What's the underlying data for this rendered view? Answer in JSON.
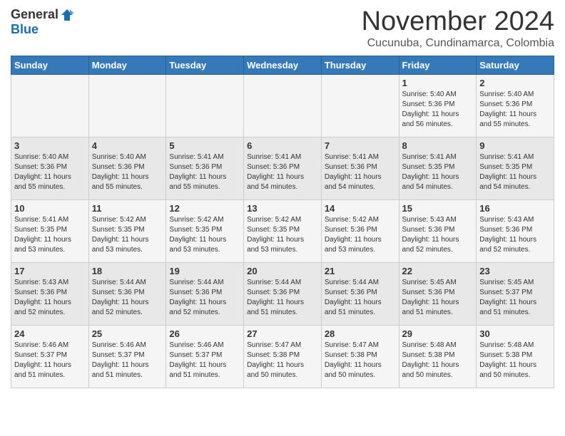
{
  "header": {
    "logo_general": "General",
    "logo_blue": "Blue",
    "month_title": "November 2024",
    "location": "Cucunuba, Cundinamarca, Colombia"
  },
  "weekdays": [
    "Sunday",
    "Monday",
    "Tuesday",
    "Wednesday",
    "Thursday",
    "Friday",
    "Saturday"
  ],
  "weeks": [
    [
      {
        "day": "",
        "info": ""
      },
      {
        "day": "",
        "info": ""
      },
      {
        "day": "",
        "info": ""
      },
      {
        "day": "",
        "info": ""
      },
      {
        "day": "",
        "info": ""
      },
      {
        "day": "1",
        "info": "Sunrise: 5:40 AM\nSunset: 5:36 PM\nDaylight: 11 hours\nand 56 minutes."
      },
      {
        "day": "2",
        "info": "Sunrise: 5:40 AM\nSunset: 5:36 PM\nDaylight: 11 hours\nand 55 minutes."
      }
    ],
    [
      {
        "day": "3",
        "info": "Sunrise: 5:40 AM\nSunset: 5:36 PM\nDaylight: 11 hours\nand 55 minutes."
      },
      {
        "day": "4",
        "info": "Sunrise: 5:40 AM\nSunset: 5:36 PM\nDaylight: 11 hours\nand 55 minutes."
      },
      {
        "day": "5",
        "info": "Sunrise: 5:41 AM\nSunset: 5:36 PM\nDaylight: 11 hours\nand 55 minutes."
      },
      {
        "day": "6",
        "info": "Sunrise: 5:41 AM\nSunset: 5:36 PM\nDaylight: 11 hours\nand 54 minutes."
      },
      {
        "day": "7",
        "info": "Sunrise: 5:41 AM\nSunset: 5:36 PM\nDaylight: 11 hours\nand 54 minutes."
      },
      {
        "day": "8",
        "info": "Sunrise: 5:41 AM\nSunset: 5:35 PM\nDaylight: 11 hours\nand 54 minutes."
      },
      {
        "day": "9",
        "info": "Sunrise: 5:41 AM\nSunset: 5:35 PM\nDaylight: 11 hours\nand 54 minutes."
      }
    ],
    [
      {
        "day": "10",
        "info": "Sunrise: 5:41 AM\nSunset: 5:35 PM\nDaylight: 11 hours\nand 53 minutes."
      },
      {
        "day": "11",
        "info": "Sunrise: 5:42 AM\nSunset: 5:35 PM\nDaylight: 11 hours\nand 53 minutes."
      },
      {
        "day": "12",
        "info": "Sunrise: 5:42 AM\nSunset: 5:35 PM\nDaylight: 11 hours\nand 53 minutes."
      },
      {
        "day": "13",
        "info": "Sunrise: 5:42 AM\nSunset: 5:35 PM\nDaylight: 11 hours\nand 53 minutes."
      },
      {
        "day": "14",
        "info": "Sunrise: 5:42 AM\nSunset: 5:36 PM\nDaylight: 11 hours\nand 53 minutes."
      },
      {
        "day": "15",
        "info": "Sunrise: 5:43 AM\nSunset: 5:36 PM\nDaylight: 11 hours\nand 52 minutes."
      },
      {
        "day": "16",
        "info": "Sunrise: 5:43 AM\nSunset: 5:36 PM\nDaylight: 11 hours\nand 52 minutes."
      }
    ],
    [
      {
        "day": "17",
        "info": "Sunrise: 5:43 AM\nSunset: 5:36 PM\nDaylight: 11 hours\nand 52 minutes."
      },
      {
        "day": "18",
        "info": "Sunrise: 5:44 AM\nSunset: 5:36 PM\nDaylight: 11 hours\nand 52 minutes."
      },
      {
        "day": "19",
        "info": "Sunrise: 5:44 AM\nSunset: 5:36 PM\nDaylight: 11 hours\nand 52 minutes."
      },
      {
        "day": "20",
        "info": "Sunrise: 5:44 AM\nSunset: 5:36 PM\nDaylight: 11 hours\nand 51 minutes."
      },
      {
        "day": "21",
        "info": "Sunrise: 5:44 AM\nSunset: 5:36 PM\nDaylight: 11 hours\nand 51 minutes."
      },
      {
        "day": "22",
        "info": "Sunrise: 5:45 AM\nSunset: 5:36 PM\nDaylight: 11 hours\nand 51 minutes."
      },
      {
        "day": "23",
        "info": "Sunrise: 5:45 AM\nSunset: 5:37 PM\nDaylight: 11 hours\nand 51 minutes."
      }
    ],
    [
      {
        "day": "24",
        "info": "Sunrise: 5:46 AM\nSunset: 5:37 PM\nDaylight: 11 hours\nand 51 minutes."
      },
      {
        "day": "25",
        "info": "Sunrise: 5:46 AM\nSunset: 5:37 PM\nDaylight: 11 hours\nand 51 minutes."
      },
      {
        "day": "26",
        "info": "Sunrise: 5:46 AM\nSunset: 5:37 PM\nDaylight: 11 hours\nand 51 minutes."
      },
      {
        "day": "27",
        "info": "Sunrise: 5:47 AM\nSunset: 5:38 PM\nDaylight: 11 hours\nand 50 minutes."
      },
      {
        "day": "28",
        "info": "Sunrise: 5:47 AM\nSunset: 5:38 PM\nDaylight: 11 hours\nand 50 minutes."
      },
      {
        "day": "29",
        "info": "Sunrise: 5:48 AM\nSunset: 5:38 PM\nDaylight: 11 hours\nand 50 minutes."
      },
      {
        "day": "30",
        "info": "Sunrise: 5:48 AM\nSunset: 5:38 PM\nDaylight: 11 hours\nand 50 minutes."
      }
    ]
  ]
}
